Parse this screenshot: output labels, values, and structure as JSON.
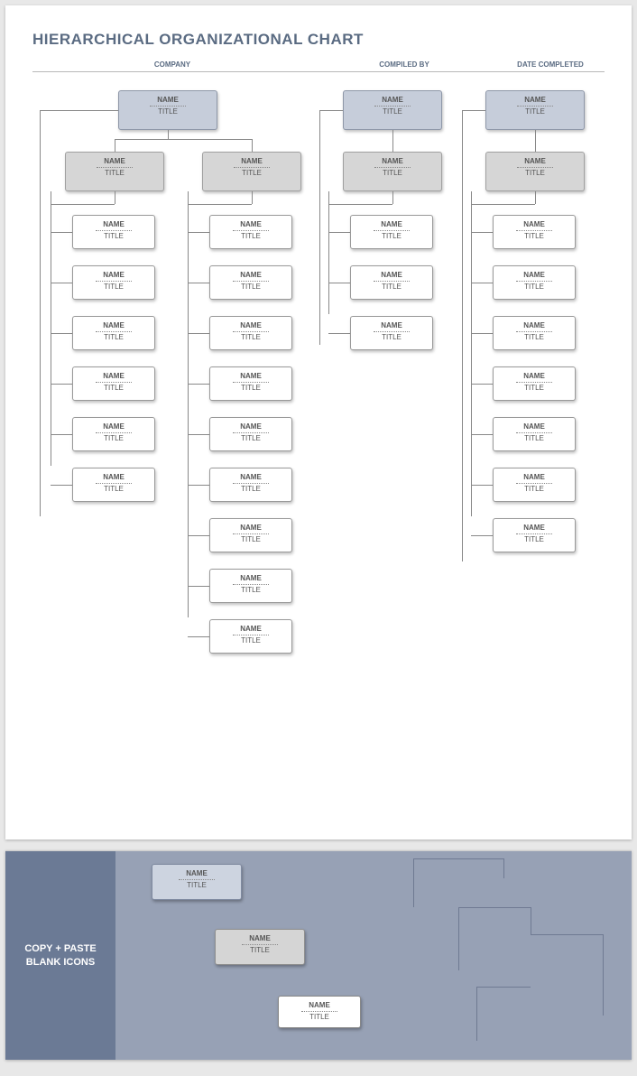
{
  "doc": {
    "title": "HIERARCHICAL ORGANIZATIONAL CHART",
    "header": {
      "company": "COMPANY",
      "compiled": "COMPILED BY",
      "date": "DATE COMPLETED"
    }
  },
  "placeholder": {
    "name": "NAME",
    "title": "TITLE"
  },
  "clipboard": {
    "label": "COPY + PASTE\nBLANK ICONS"
  },
  "chart_data": {
    "type": "tree",
    "title": "Hierarchical Organizational Chart",
    "trees": [
      {
        "root": {
          "name": "NAME",
          "title": "TITLE"
        },
        "children": [
          {
            "name": "NAME",
            "title": "TITLE",
            "children": [
              {
                "name": "NAME",
                "title": "TITLE"
              },
              {
                "name": "NAME",
                "title": "TITLE"
              },
              {
                "name": "NAME",
                "title": "TITLE"
              },
              {
                "name": "NAME",
                "title": "TITLE"
              },
              {
                "name": "NAME",
                "title": "TITLE"
              },
              {
                "name": "NAME",
                "title": "TITLE"
              }
            ]
          },
          {
            "name": "NAME",
            "title": "TITLE",
            "children": [
              {
                "name": "NAME",
                "title": "TITLE"
              },
              {
                "name": "NAME",
                "title": "TITLE"
              },
              {
                "name": "NAME",
                "title": "TITLE"
              },
              {
                "name": "NAME",
                "title": "TITLE"
              },
              {
                "name": "NAME",
                "title": "TITLE"
              },
              {
                "name": "NAME",
                "title": "TITLE"
              },
              {
                "name": "NAME",
                "title": "TITLE"
              },
              {
                "name": "NAME",
                "title": "TITLE"
              },
              {
                "name": "NAME",
                "title": "TITLE"
              }
            ]
          }
        ]
      },
      {
        "root": {
          "name": "NAME",
          "title": "TITLE"
        },
        "children": [
          {
            "name": "NAME",
            "title": "TITLE",
            "children": [
              {
                "name": "NAME",
                "title": "TITLE"
              },
              {
                "name": "NAME",
                "title": "TITLE"
              },
              {
                "name": "NAME",
                "title": "TITLE"
              }
            ]
          }
        ]
      },
      {
        "root": {
          "name": "NAME",
          "title": "TITLE"
        },
        "children": [
          {
            "name": "NAME",
            "title": "TITLE",
            "children": [
              {
                "name": "NAME",
                "title": "TITLE"
              },
              {
                "name": "NAME",
                "title": "TITLE"
              },
              {
                "name": "NAME",
                "title": "TITLE"
              },
              {
                "name": "NAME",
                "title": "TITLE"
              },
              {
                "name": "NAME",
                "title": "TITLE"
              },
              {
                "name": "NAME",
                "title": "TITLE"
              },
              {
                "name": "NAME",
                "title": "TITLE"
              }
            ]
          }
        ]
      }
    ]
  }
}
